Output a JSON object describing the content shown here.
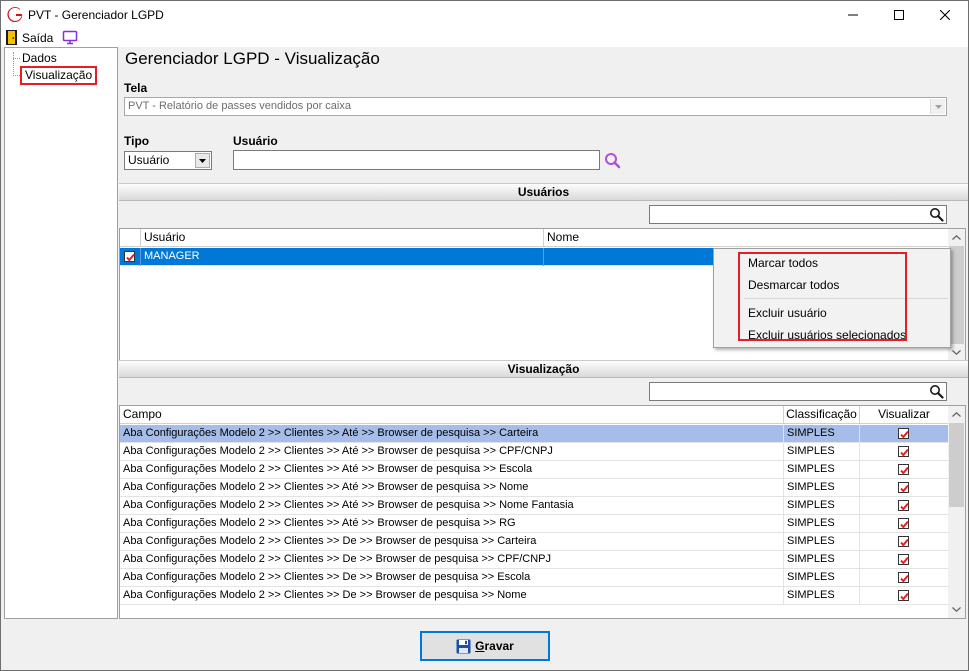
{
  "window": {
    "title": "PVT - Gerenciador LGPD"
  },
  "menu": {
    "exit_label": "Saída"
  },
  "tree": {
    "items": [
      {
        "label": "Dados"
      },
      {
        "label": "Visualização"
      }
    ]
  },
  "page": {
    "title": "Gerenciador LGPD - Visualização",
    "tela_label": "Tela",
    "tela_value": "PVT - Relatório de passes vendidos por caixa",
    "tipo_label": "Tipo",
    "tipo_value": "Usuário",
    "usuario_label": "Usuário",
    "usuario_value": ""
  },
  "users_section": {
    "header": "Usuários",
    "search_value": "",
    "columns": [
      "Usuário",
      "Nome"
    ],
    "rows": [
      {
        "usuario": "MANAGER",
        "nome": "",
        "checked": true
      }
    ]
  },
  "context_menu": {
    "items": [
      "Marcar todos",
      "Desmarcar todos",
      "Excluir usuário",
      "Excluir usuários selecionados"
    ]
  },
  "view_section": {
    "header": "Visualização",
    "search_value": "",
    "columns": [
      "Campo",
      "Classificação",
      "Visualizar"
    ],
    "rows": [
      {
        "campo": "Aba Configurações Modelo 2 >> Clientes >> Até >> Browser de pesquisa >> Carteira",
        "classificacao": "SIMPLES",
        "visualizar": true
      },
      {
        "campo": "Aba Configurações Modelo 2 >> Clientes >> Até >> Browser de pesquisa >> CPF/CNPJ",
        "classificacao": "SIMPLES",
        "visualizar": true
      },
      {
        "campo": "Aba Configurações Modelo 2 >> Clientes >> Até >> Browser de pesquisa >> Escola",
        "classificacao": "SIMPLES",
        "visualizar": true
      },
      {
        "campo": "Aba Configurações Modelo 2 >> Clientes >> Até >> Browser de pesquisa >> Nome",
        "classificacao": "SIMPLES",
        "visualizar": true
      },
      {
        "campo": "Aba Configurações Modelo 2 >> Clientes >> Até >> Browser de pesquisa >> Nome Fantasia",
        "classificacao": "SIMPLES",
        "visualizar": true
      },
      {
        "campo": "Aba Configurações Modelo 2 >> Clientes >> Até >> Browser de pesquisa >> RG",
        "classificacao": "SIMPLES",
        "visualizar": true
      },
      {
        "campo": "Aba Configurações Modelo 2 >> Clientes >> De >> Browser de pesquisa >> Carteira",
        "classificacao": "SIMPLES",
        "visualizar": true
      },
      {
        "campo": "Aba Configurações Modelo 2 >> Clientes >> De >> Browser de pesquisa >> CPF/CNPJ",
        "classificacao": "SIMPLES",
        "visualizar": true
      },
      {
        "campo": "Aba Configurações Modelo 2 >> Clientes >> De >> Browser de pesquisa >> Escola",
        "classificacao": "SIMPLES",
        "visualizar": true
      },
      {
        "campo": "Aba Configurações Modelo 2 >> Clientes >> De >> Browser de pesquisa >> Nome",
        "classificacao": "SIMPLES",
        "visualizar": true
      }
    ]
  },
  "footer": {
    "save_label_underlined": "G",
    "save_label_rest": "ravar"
  },
  "colors": {
    "accent": "#0078d7",
    "highlight_red": "#e31e24",
    "row_selected_light": "#a5bde8",
    "search_icon": "#1a1a1a",
    "lookup_icon": "#b04fd8"
  },
  "icons": {
    "app": "app-logo-icon",
    "exit": "exit-door-icon",
    "monitor": "monitor-icon",
    "search": "search-icon",
    "lookup": "lookup-magnifier-icon",
    "save": "floppy-disk-icon"
  }
}
